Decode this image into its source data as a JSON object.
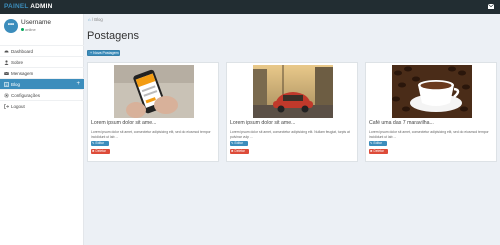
{
  "brand": {
    "part1": "PAINEL",
    "part2": "ADMIN"
  },
  "user": {
    "initials": "•••",
    "name": "Username",
    "status": "online"
  },
  "menu": [
    {
      "label": "Dashboard",
      "icon": "dashboard-icon"
    },
    {
      "label": "Sobre",
      "icon": "user-icon"
    },
    {
      "label": "Mensagem",
      "icon": "envelope-icon"
    },
    {
      "label": "Blog",
      "icon": "blog-icon",
      "active": true
    },
    {
      "label": "Configurações",
      "icon": "gear-icon"
    },
    {
      "label": "Logout",
      "icon": "logout-icon"
    }
  ],
  "breadcrumb": {
    "home": "⌂",
    "separator": "/",
    "current": "Blog"
  },
  "page": {
    "title": "Postagens",
    "new_button": "+ Nova Postagem"
  },
  "posts": [
    {
      "title": "Lorem ipsum dolor sit ame...",
      "excerpt": "Lorem ipsum dolor sit amet, consectetur adipisicing elit, sed do eiusmod tempor incididunt ut lab ...",
      "edit": "✎ Editar",
      "delete": "✖ Deletar",
      "image": "phone-app-photo"
    },
    {
      "title": "Lorem ipsum dolor sit ame...",
      "excerpt": "Lorem ipsum dolor sit amet, consectetur adipisicing elit. Nullam feugiat, turpis at pulvinar vulp ...",
      "edit": "✎ Editar",
      "delete": "✖ Deletar",
      "image": "red-car-street-photo"
    },
    {
      "title": "Café uma das 7 maravilha...",
      "excerpt": "Lorem ipsum dolor sit amet, consectetur adipisicing elit, sed do eiusmod tempor incididunt ut lab ...",
      "edit": "✎ Editar",
      "delete": "✖ Deletar",
      "image": "coffee-cup-photo"
    }
  ],
  "colors": {
    "primary": "#3c8dbc",
    "danger": "#dd4b39",
    "topbar": "#222d32",
    "online": "#00a65a",
    "background": "#ecf0f5"
  }
}
